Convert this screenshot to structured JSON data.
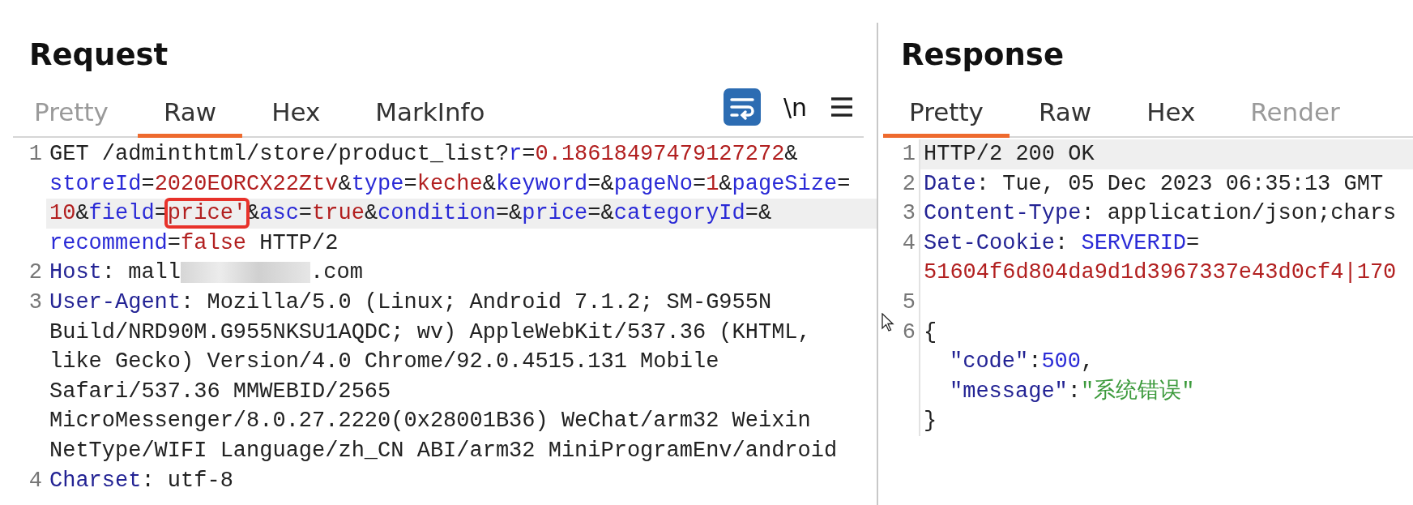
{
  "request": {
    "title": "Request",
    "tabs": [
      {
        "label": "Pretty",
        "selected": false,
        "disabled": true
      },
      {
        "label": "Raw",
        "selected": true,
        "disabled": false
      },
      {
        "label": "Hex",
        "selected": false,
        "disabled": false
      },
      {
        "label": "MarkInfo",
        "selected": false,
        "disabled": false
      }
    ],
    "toolbar": [
      {
        "kind": "wrap",
        "on": true
      },
      {
        "kind": "text",
        "label": "\\n"
      },
      {
        "kind": "menu"
      }
    ],
    "lines": [
      {
        "number": "1",
        "rows": [
          {
            "current": false,
            "segments": [
              {
                "text": "GET /adminthtml/store/product_list?",
                "kind": "plain"
              },
              {
                "text": "r",
                "kind": "name"
              },
              {
                "text": "=",
                "kind": "plain"
              },
              {
                "text": "0.18618497479127272",
                "kind": "value"
              },
              {
                "text": "&",
                "kind": "plain"
              }
            ]
          },
          {
            "current": false,
            "segments": [
              {
                "text": "storeId",
                "kind": "name"
              },
              {
                "text": "=",
                "kind": "plain"
              },
              {
                "text": "2020EORCX22Ztv",
                "kind": "value"
              },
              {
                "text": "&",
                "kind": "plain"
              },
              {
                "text": "type",
                "kind": "name"
              },
              {
                "text": "=",
                "kind": "plain"
              },
              {
                "text": "keche",
                "kind": "value"
              },
              {
                "text": "&",
                "kind": "plain"
              },
              {
                "text": "keyword",
                "kind": "name"
              },
              {
                "text": "=&",
                "kind": "plain"
              },
              {
                "text": "pageNo",
                "kind": "name"
              },
              {
                "text": "=",
                "kind": "plain"
              },
              {
                "text": "1",
                "kind": "value"
              },
              {
                "text": "&",
                "kind": "plain"
              },
              {
                "text": "pageSize",
                "kind": "name"
              },
              {
                "text": "=",
                "kind": "plain"
              }
            ]
          },
          {
            "current": true,
            "segments": [
              {
                "text": "10",
                "kind": "value"
              },
              {
                "text": "&",
                "kind": "plain"
              },
              {
                "text": "field",
                "kind": "name"
              },
              {
                "text": "=",
                "kind": "plain"
              },
              {
                "text": "price'",
                "kind": "value",
                "boxed": true,
                "caret": true
              },
              {
                "text": "&",
                "kind": "plain"
              },
              {
                "text": "asc",
                "kind": "name"
              },
              {
                "text": "=",
                "kind": "plain"
              },
              {
                "text": "true",
                "kind": "value"
              },
              {
                "text": "&",
                "kind": "plain"
              },
              {
                "text": "condition",
                "kind": "name"
              },
              {
                "text": "=&",
                "kind": "plain"
              },
              {
                "text": "price",
                "kind": "name"
              },
              {
                "text": "=&",
                "kind": "plain"
              },
              {
                "text": "categoryId",
                "kind": "name"
              },
              {
                "text": "=&",
                "kind": "plain"
              }
            ]
          },
          {
            "current": false,
            "segments": [
              {
                "text": "recommend",
                "kind": "name"
              },
              {
                "text": "=",
                "kind": "plain"
              },
              {
                "text": "false",
                "kind": "value"
              },
              {
                "text": " HTTP/2",
                "kind": "plain"
              }
            ]
          }
        ]
      },
      {
        "number": "2",
        "rows": [
          {
            "current": false,
            "segments": [
              {
                "text": "Host",
                "kind": "header"
              },
              {
                "text": ": mall",
                "kind": "plain"
              },
              {
                "kind": "blur"
              },
              {
                "text": ".com",
                "kind": "plain"
              }
            ]
          }
        ]
      },
      {
        "number": "3",
        "rows": [
          {
            "current": false,
            "segments": [
              {
                "text": "User-Agent",
                "kind": "header"
              },
              {
                "text": ": Mozilla/5.0 (Linux; Android 7.1.2; SM-G955N",
                "kind": "plain"
              }
            ]
          },
          {
            "current": false,
            "segments": [
              {
                "text": "Build/NRD90M.G955NKSU1AQDC; wv) AppleWebKit/537.36 (KHTML,",
                "kind": "plain"
              }
            ]
          },
          {
            "current": false,
            "segments": [
              {
                "text": "like Gecko) Version/4.0 Chrome/92.0.4515.131 Mobile",
                "kind": "plain"
              }
            ]
          },
          {
            "current": false,
            "segments": [
              {
                "text": "Safari/537.36 MMWEBID/2565",
                "kind": "plain"
              }
            ]
          },
          {
            "current": false,
            "segments": [
              {
                "text": "MicroMessenger/8.0.27.2220(0x28001B36) WeChat/arm32 Weixin",
                "kind": "plain"
              }
            ]
          },
          {
            "current": false,
            "segments": [
              {
                "text": "NetType/WIFI Language/zh_CN ABI/arm32 MiniProgramEnv/android",
                "kind": "plain"
              }
            ]
          }
        ]
      },
      {
        "number": "4",
        "rows": [
          {
            "current": false,
            "segments": [
              {
                "text": "Charset",
                "kind": "header"
              },
              {
                "text": ": utf-8",
                "kind": "plain"
              }
            ]
          }
        ]
      }
    ]
  },
  "response": {
    "title": "Response",
    "tabs": [
      {
        "label": "Pretty",
        "selected": true,
        "disabled": false
      },
      {
        "label": "Raw",
        "selected": false,
        "disabled": false
      },
      {
        "label": "Hex",
        "selected": false,
        "disabled": false
      },
      {
        "label": "Render",
        "selected": false,
        "disabled": true
      }
    ],
    "lines": [
      {
        "number": "1",
        "rows": [
          {
            "current": true,
            "segments": [
              {
                "text": "HTTP/2 200 OK",
                "kind": "plain"
              }
            ]
          }
        ]
      },
      {
        "number": "2",
        "rows": [
          {
            "current": false,
            "segments": [
              {
                "text": "Date",
                "kind": "header"
              },
              {
                "text": ": Tue, 05 Dec 2023 06:35:13 GMT",
                "kind": "plain"
              }
            ]
          }
        ]
      },
      {
        "number": "3",
        "rows": [
          {
            "current": false,
            "segments": [
              {
                "text": "Content-Type",
                "kind": "header"
              },
              {
                "text": ": application/json;chars",
                "kind": "plain"
              }
            ]
          }
        ]
      },
      {
        "number": "4",
        "rows": [
          {
            "current": false,
            "segments": [
              {
                "text": "Set-Cookie",
                "kind": "header"
              },
              {
                "text": ": ",
                "kind": "plain"
              },
              {
                "text": "SERVERID",
                "kind": "name"
              },
              {
                "text": "=",
                "kind": "plain"
              }
            ]
          },
          {
            "current": false,
            "segments": [
              {
                "text": "51604f6d804da9d1d3967337e43d0cf4|170",
                "kind": "value"
              }
            ]
          }
        ]
      },
      {
        "number": "5",
        "rows": [
          {
            "current": false,
            "segments": []
          }
        ]
      },
      {
        "number": "6",
        "rows": [
          {
            "current": false,
            "segments": [
              {
                "text": "{",
                "kind": "plain"
              }
            ]
          },
          {
            "current": false,
            "indent": true,
            "segments": [
              {
                "text": "\"code\"",
                "kind": "header"
              },
              {
                "text": ":",
                "kind": "plain"
              },
              {
                "text": "500",
                "kind": "number"
              },
              {
                "text": ",",
                "kind": "plain"
              }
            ]
          },
          {
            "current": false,
            "indent": true,
            "segments": [
              {
                "text": "\"message\"",
                "kind": "header"
              },
              {
                "text": ":",
                "kind": "plain"
              },
              {
                "text": "\"系统错误\"",
                "kind": "string"
              }
            ]
          },
          {
            "current": false,
            "segments": [
              {
                "text": "}",
                "kind": "plain"
              }
            ]
          }
        ]
      }
    ]
  }
}
